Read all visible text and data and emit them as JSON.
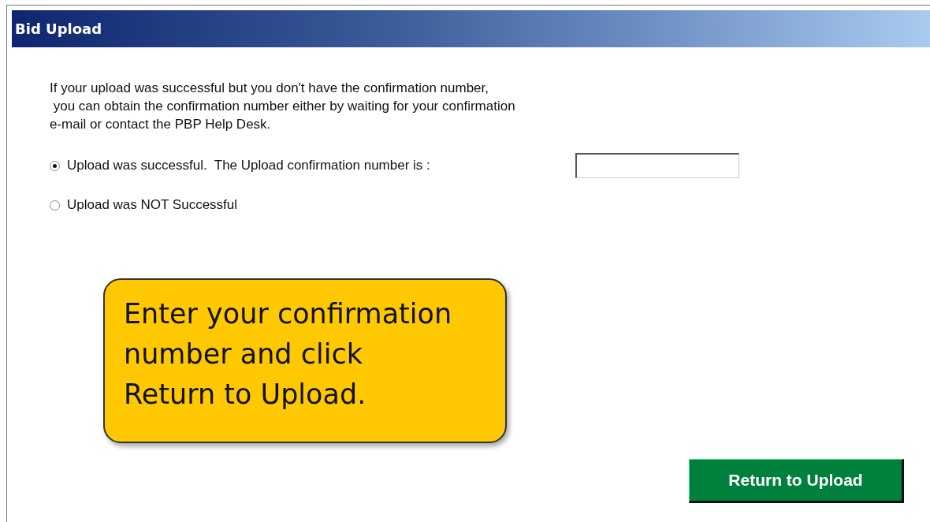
{
  "window": {
    "title": "Bid Upload"
  },
  "intro": "If your upload was successful but you don't have the confirmation number,\n you can obtain the confirmation number either by waiting for your confirmation\ne-mail or contact the PBP Help Desk.",
  "options": [
    {
      "label": "Upload was successful.  The Upload confirmation number is :",
      "selected": true,
      "kind": "with-field"
    },
    {
      "label": "Upload was NOT Successful",
      "selected": false,
      "kind": "plain"
    }
  ],
  "callout": "Enter your confirmation\nnumber and click\nReturn to Upload.",
  "buttons": [
    "Return to Upload"
  ]
}
